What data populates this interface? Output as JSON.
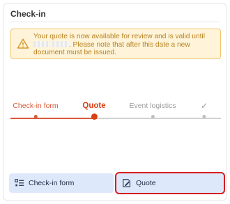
{
  "card": {
    "title": "Check-in"
  },
  "alert": {
    "message_part1": "Your quote is now available for review and is valid until",
    "message_part2": ". Please note that after this date a new document must be issued."
  },
  "stepper": {
    "steps": [
      {
        "label": "Check-in form",
        "state": "complete"
      },
      {
        "label": "Quote",
        "state": "current"
      },
      {
        "label": "Event logistics",
        "state": "upcoming"
      },
      {
        "label": "✓",
        "state": "upcoming"
      }
    ]
  },
  "buttons": {
    "checkin": {
      "label": "Check-in form",
      "icon": "list-icon"
    },
    "quote": {
      "label": "Quote",
      "icon": "edit-document-icon"
    }
  },
  "colors": {
    "accent": "#d93f14",
    "warning_text": "#b7801e",
    "button_bg": "#dde8fb"
  }
}
